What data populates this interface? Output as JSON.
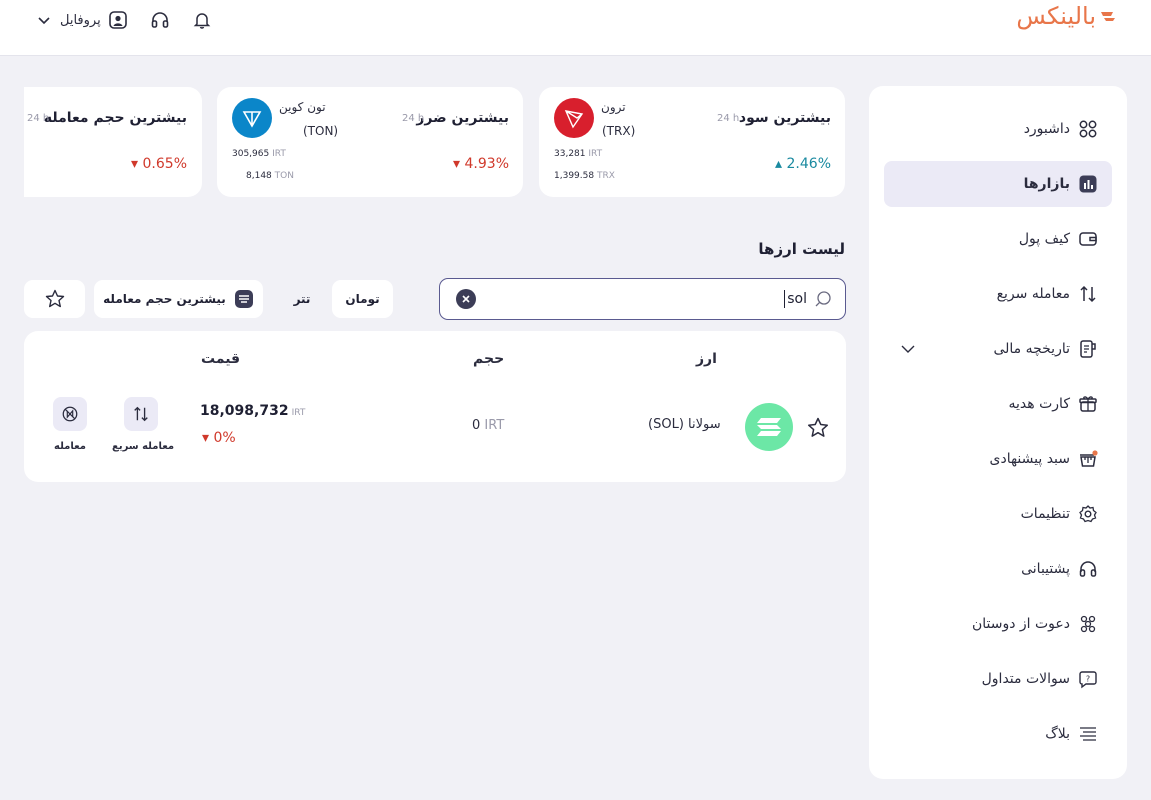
{
  "header": {
    "logo_text": "بالینکس",
    "profile_label": "پروفایل",
    "icons": [
      "chevron-down-icon",
      "user-icon",
      "headset-icon",
      "bell-icon"
    ]
  },
  "sidebar": {
    "items": [
      {
        "label": "داشبورد",
        "icon": "dashboard-icon",
        "active": false
      },
      {
        "label": "بازارها",
        "icon": "chart-icon",
        "active": true
      },
      {
        "label": "کیف پول",
        "icon": "wallet-icon",
        "active": false
      },
      {
        "label": "معامله سریع",
        "icon": "swap-icon",
        "active": false
      },
      {
        "label": "تاریخچه مالی",
        "icon": "history-icon",
        "active": false,
        "expandable": true
      },
      {
        "label": "کارت هدیه",
        "icon": "gift-icon",
        "active": false
      },
      {
        "label": "سبد پیشنهادی",
        "icon": "basket-icon",
        "active": false
      },
      {
        "label": "تنظیمات",
        "icon": "gear-icon",
        "active": false
      },
      {
        "label": "پشتیبانی",
        "icon": "headset-icon",
        "active": false
      },
      {
        "label": "دعوت از دوستان",
        "icon": "users-icon",
        "active": false
      },
      {
        "label": "سوالات متداول",
        "icon": "question-icon",
        "active": false
      },
      {
        "label": "بلاگ",
        "icon": "menu-lines-icon",
        "active": false
      }
    ]
  },
  "stats": {
    "profit": {
      "title": "بیشترین سود",
      "period": "24 h",
      "change": "▴ 2.46%",
      "coin_name": "ترون",
      "coin_symbol": "(TRX)",
      "price": "33,281",
      "price_unit": "IRT",
      "amount": "1,399.58",
      "amount_unit": "TRX"
    },
    "loss": {
      "title": "بیشترین ضرر",
      "period": "24 h",
      "change": "▾ 4.93%",
      "coin_name": "تون کوین",
      "coin_symbol": "(TON)",
      "price": "305,965",
      "price_unit": "IRT",
      "amount": "8,148",
      "amount_unit": "TON"
    },
    "volume": {
      "title": "بیشترین حجم معامله",
      "period": "24 h",
      "change": "▾ 0.65%"
    }
  },
  "list": {
    "title": "لیست ارزها",
    "search_value": "sol",
    "filters": {
      "toman": "تومان",
      "tether": "تتر",
      "sort": "بیشترین حجم معامله"
    },
    "columns": {
      "currency": "ارز",
      "volume": "حجم",
      "price": "قیمت"
    },
    "rows": [
      {
        "name": "سولانا (SOL)",
        "volume": "0",
        "volume_unit": "IRT",
        "price": "18,098,732",
        "price_unit": "IRT",
        "change": "▾ 0%",
        "quick_trade_label": "معامله سریع",
        "trade_label": "معامله"
      }
    ]
  },
  "colors": {
    "accent": "#3c3d57",
    "up": "#1a8aa0",
    "down": "#d0392b",
    "brand": "#e8764a",
    "active_bg": "#ebeaf6"
  }
}
